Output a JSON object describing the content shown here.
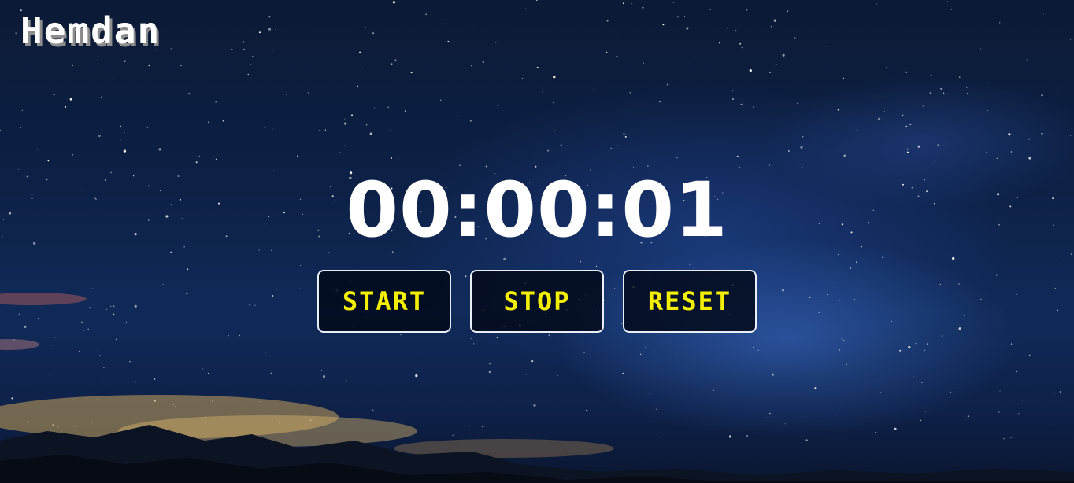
{
  "header": {
    "brand": "Hemdan"
  },
  "stopwatch": {
    "display": "00:00:01"
  },
  "controls": {
    "start_label": "START",
    "stop_label": "STOP",
    "reset_label": "RESET"
  },
  "colors": {
    "button_text": "#f4ee00",
    "button_border": "#e9eef7",
    "timer_text": "#ffffff",
    "sky": "#0d2147"
  }
}
